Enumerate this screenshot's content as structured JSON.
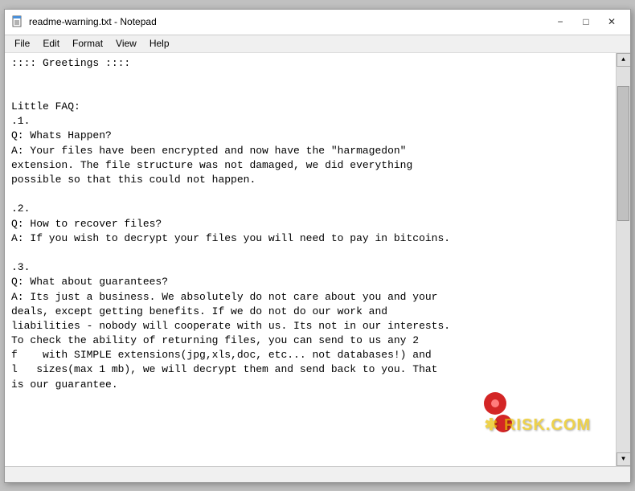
{
  "window": {
    "title": "readme-warning.txt - Notepad",
    "icon": "📄"
  },
  "titlebar": {
    "minimize_label": "−",
    "maximize_label": "□",
    "close_label": "✕"
  },
  "menu": {
    "items": [
      "File",
      "Edit",
      "Format",
      "View",
      "Help"
    ]
  },
  "content": {
    "text": ":::: Greetings ::::\n\n\nLittle FAQ:\n.1.\nQ: Whats Happen?\nA: Your files have been encrypted and now have the \"harmagedon\"\nextension. The file structure was not damaged, we did everything\npossible so that this could not happen.\n\n.2.\nQ: How to recover files?\nA: If you wish to decrypt your files you will need to pay in bitcoins.\n\n.3.\nQ: What about guarantees?\nA: Its just a business. We absolutely do not care about you and your\ndeals, except getting benefits. If we do not do our work and\nliabilities - nobody will cooperate with us. Its not in our interests.\nTo check the ability of returning files, you can send to us any 2\nf    with SIMPLE extensions(jpg,xls,doc, etc... not databases!) and\nl   sizes(max 1 mb), we will decrypt them and send back to you. That\nis our guarantee."
  },
  "watermark": {
    "text": "✱ RISK.COM"
  },
  "statusbar": {
    "text": ""
  }
}
